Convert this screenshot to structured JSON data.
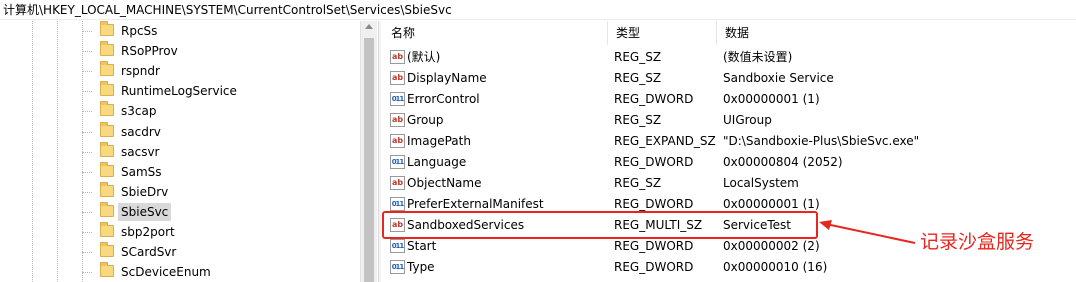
{
  "address_bar": {
    "path": "计算机\\HKEY_LOCAL_MACHINE\\SYSTEM\\CurrentControlSet\\Services\\SbieSvc"
  },
  "tree": {
    "items": [
      {
        "label": "RpcSs",
        "selected": false
      },
      {
        "label": "RSoPProv",
        "selected": false
      },
      {
        "label": "rspndr",
        "selected": false
      },
      {
        "label": "RuntimeLogService",
        "selected": false
      },
      {
        "label": "s3cap",
        "selected": false
      },
      {
        "label": "sacdrv",
        "selected": false
      },
      {
        "label": "sacsvr",
        "selected": false
      },
      {
        "label": "SamSs",
        "selected": false
      },
      {
        "label": "SbieDrv",
        "selected": false
      },
      {
        "label": "SbieSvc",
        "selected": true
      },
      {
        "label": "sbp2port",
        "selected": false
      },
      {
        "label": "SCardSvr",
        "selected": false
      },
      {
        "label": "ScDeviceEnum",
        "selected": false
      }
    ]
  },
  "values_list": {
    "headers": {
      "name": "名称",
      "type": "类型",
      "data": "数据"
    },
    "rows": [
      {
        "icon": "string-value-icon",
        "name": "(默认)",
        "type": "REG_SZ",
        "data": "(数值未设置)"
      },
      {
        "icon": "string-value-icon",
        "name": "DisplayName",
        "type": "REG_SZ",
        "data": "Sandboxie Service"
      },
      {
        "icon": "binary-value-icon",
        "name": "ErrorControl",
        "type": "REG_DWORD",
        "data": "0x00000001 (1)"
      },
      {
        "icon": "string-value-icon",
        "name": "Group",
        "type": "REG_SZ",
        "data": "UIGroup"
      },
      {
        "icon": "string-value-icon",
        "name": "ImagePath",
        "type": "REG_EXPAND_SZ",
        "data": "\"D:\\Sandboxie-Plus\\SbieSvc.exe\""
      },
      {
        "icon": "binary-value-icon",
        "name": "Language",
        "type": "REG_DWORD",
        "data": "0x00000804 (2052)"
      },
      {
        "icon": "string-value-icon",
        "name": "ObjectName",
        "type": "REG_SZ",
        "data": "LocalSystem"
      },
      {
        "icon": "binary-value-icon",
        "name": "PreferExternalManifest",
        "type": "REG_DWORD",
        "data": "0x00000001 (1)"
      },
      {
        "icon": "string-value-icon",
        "name": "SandboxedServices",
        "type": "REG_MULTI_SZ",
        "data": "ServiceTest"
      },
      {
        "icon": "binary-value-icon",
        "name": "Start",
        "type": "REG_DWORD",
        "data": "0x00000002 (2)"
      },
      {
        "icon": "binary-value-icon",
        "name": "Type",
        "type": "REG_DWORD",
        "data": "0x00000010 (16)"
      }
    ]
  },
  "annotation": {
    "text": "记录沙盒服务",
    "color": "#e8261e"
  },
  "colors": {
    "folder": "#f9d97e",
    "selection": "#d9d9d9",
    "highlight": "#e8261e"
  }
}
